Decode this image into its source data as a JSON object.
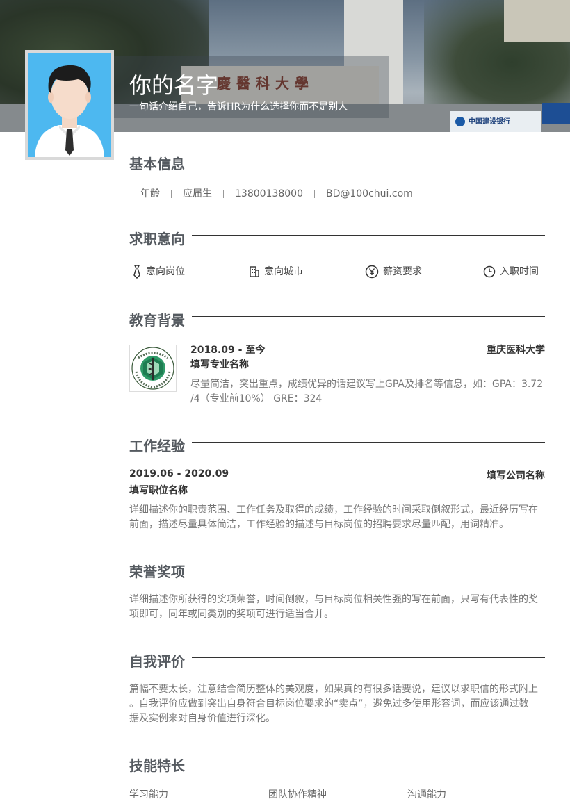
{
  "header": {
    "name": "你的名字",
    "tagline": "一句话介绍自己，告诉HR为什么选择你而不是别人",
    "banner_gate_text": "慶醫科大學",
    "banner_bank_text": "中国建设银行"
  },
  "sections": {
    "basic": "基本信息",
    "intent": "求职意向",
    "education": "教育背景",
    "work": "工作经验",
    "honors": "荣誉奖项",
    "self": "自我评价",
    "skills": "技能特长"
  },
  "basic_info": {
    "age": "年龄",
    "status": "应届生",
    "phone": "13800138000",
    "email": "BD@100chui.com"
  },
  "job_intent": {
    "position": "意向岗位",
    "city": "意向城市",
    "salary": "薪资要求",
    "start": "入职时间"
  },
  "education": {
    "period": "2018.09 - 至今",
    "school": "重庆医科大学",
    "major": "填写专业名称",
    "desc_line1": "尽量简洁，突出重点，成绩优异的话建议写上GPA及排名等信息，如：GPA：3.72",
    "desc_line2": "/4（专业前10%） GRE：324"
  },
  "work": {
    "period": "2019.06 - 2020.09",
    "company": "填写公司名称",
    "position": "填写职位名称",
    "desc_line1": "详细描述你的职责范围、工作任务及取得的成绩，工作经验的时间采取倒叙形式，最近经历写在",
    "desc_line2": "前面，描述尽量具体简洁，工作经验的描述与目标岗位的招聘要求尽量匹配，用词精准。"
  },
  "honors": {
    "line1": "详细描述你所获得的奖项荣誉，时间倒叙，与目标岗位相关性强的写在前面，只写有代表性的奖",
    "line2": "项即可，同年或同类别的奖项可进行适当合并。"
  },
  "self_eval": {
    "line1": "篇幅不要太长，注意结合简历整体的美观度，如果真的有很多话要说，建议以求职信的形式附上",
    "line2": "。自我评价应做到突出自身符合目标岗位要求的“卖点”，避免过多使用形容词，而应该通过数",
    "line3": "据及实例来对自身价值进行深化。"
  },
  "skills": {
    "items": [
      "学习能力",
      "团队协作精神",
      "沟通能力"
    ]
  }
}
